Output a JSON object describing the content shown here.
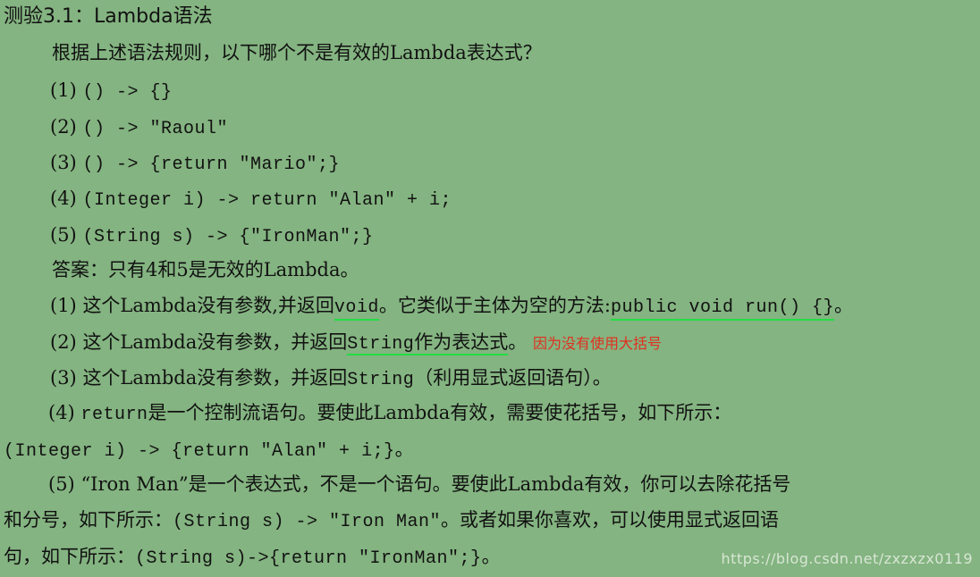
{
  "title": "测验3.1：Lambda语法",
  "question": "根据上述语法规则，以下哪个不是有效的Lambda表达式？",
  "options": [
    {
      "num": "(1)",
      "code": "() -> {}"
    },
    {
      "num": "(2)",
      "code": "() -> \"Raoul\""
    },
    {
      "num": "(3)",
      "code": "() -> {return \"Mario\";}"
    },
    {
      "num": "(4)",
      "code": "(Integer i) -> return \"Alan\" + i;"
    },
    {
      "num": "(5)",
      "code": "(String s) -> {\"IronMan\";}"
    }
  ],
  "answer": "答案：只有4和5是无效的Lambda。",
  "exp1": {
    "num": "(1)",
    "t1": "这个Lambda没有参数,并返回",
    "c1": "void",
    "t2": "。它类似于主体为空的方法:",
    "c2": "public void run() {}",
    "t3": "。"
  },
  "exp2": {
    "num": "(2)",
    "t1": "这个Lambda没有参数，并返回",
    "c1": "String",
    "t2": "作为表达式",
    "t3": "。",
    "note": "因为没有使用大括号"
  },
  "exp3": {
    "num": "(3)",
    "t1": "这个Lambda没有参数，并返回",
    "c1": "String",
    "t2": "（利用显式返回语句）。"
  },
  "exp4": {
    "num": "(4)",
    "c1": "return",
    "t1": "是一个控制流语句。要使此Lambda有效，需要使花括号，如下所示：",
    "c2": "(Integer i) -> {return \"Alan\" + i;}",
    "t2": "。"
  },
  "exp5": {
    "num": "(5)",
    "t1": "“Iron Man”是一个表达式，不是一个语句。要使此Lambda有效，你可以去除花括号",
    "t2": "和分号，如下所示：",
    "c1": "(String s) -> \"Iron Man\"",
    "t3": "。或者如果你喜欢，可以使用显式返回语",
    "t4": "句，如下所示：",
    "c2": "(String s)->{return \"IronMan\";}",
    "t5": "。"
  },
  "watermark": "https://blog.csdn.net/zxzxzx0119"
}
